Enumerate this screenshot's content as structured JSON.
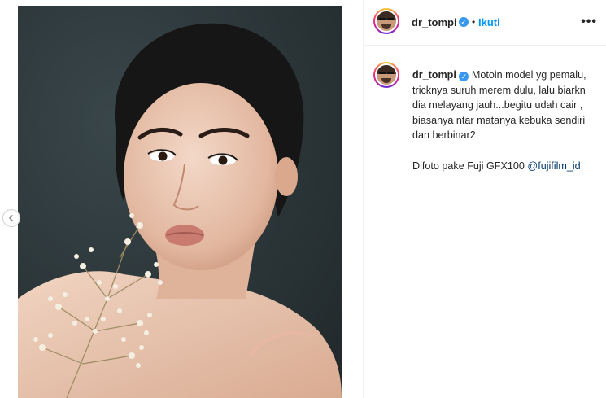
{
  "post": {
    "username": "dr_tompi",
    "follow_label": "Ikuti",
    "more_icon": "more-horizontal-icon",
    "separator": "•"
  },
  "caption": {
    "username": "dr_tompi",
    "lines": [
      "Motoin model yg pemalu,",
      "tricknya suruh merem dulu, lalu biarkn",
      "dia melayang jauh...begitu udah cair ,",
      "biasanya ntar matanya kebuka sendiri",
      "dan berbinar2"
    ],
    "footer_text": "Difoto pake Fuji GFX100 ",
    "mention": "@fujifilm_id"
  },
  "colors": {
    "link": "#0095f6",
    "mention": "#00376b",
    "verified": "#3897f0",
    "photo_background": "#2c3538"
  }
}
